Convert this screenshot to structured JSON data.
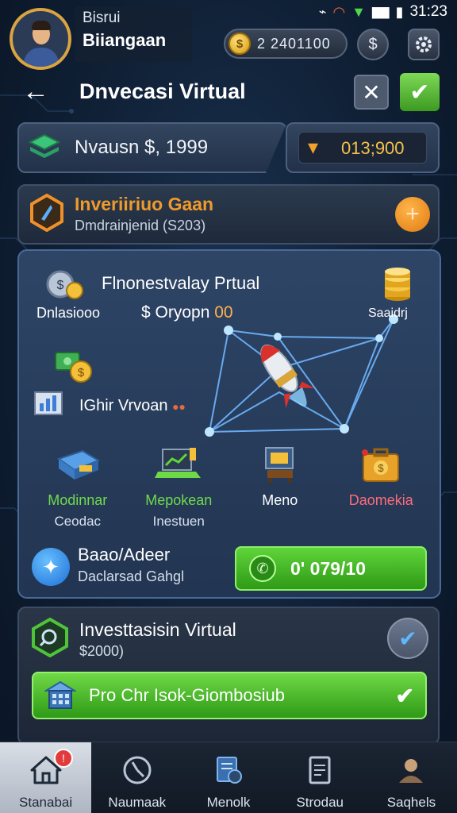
{
  "status_bar": {
    "time": "31:23"
  },
  "profile": {
    "greeting": "Bisrui",
    "name": "Biiangaan"
  },
  "wallet": {
    "coins": "2 2401100"
  },
  "header": {
    "title": "Dnvecasi Virtual"
  },
  "balance": {
    "label": "Nvausn $, 1999"
  },
  "reward": {
    "value": "013;900"
  },
  "invest_card": {
    "title": "Inveriiriuo Gaan",
    "subtitle": "Dmdrainjenid (S203)"
  },
  "main_panel": {
    "title": "Flnonestvalay Prtual",
    "left_label": "Dnlasiooo",
    "mid_label_prefix": "$ Oryopn",
    "mid_label_value": "00",
    "right_label": "Saaidrj",
    "chart_label": "IGhir Vrvoan",
    "chart_dots": "●●",
    "grid": [
      {
        "name": "grid-item-modinnar",
        "l1": "Modinnar",
        "l2": "Ceodac",
        "color": "#6fdb4a",
        "icon": "server-icon"
      },
      {
        "name": "grid-item-mepokean",
        "l1": "Mepokean",
        "l2": "Inestuen",
        "color": "#6fdb4a",
        "icon": "laptop-chart-icon"
      },
      {
        "name": "grid-item-meno",
        "l1": "Meno",
        "l2": "",
        "color": "#ffffff",
        "icon": "monitor-icon"
      },
      {
        "name": "grid-item-daomekia",
        "l1": "Daomekia",
        "l2": "",
        "color": "#ff6b7a",
        "icon": "briefcase-icon"
      }
    ],
    "support_title": "Baao/Adeer",
    "support_sub": "Daclarsad Gahgl",
    "action_value": "0' 079/10"
  },
  "bottom_card": {
    "title": "Investtasisin Virtual",
    "subtitle": "$2000)",
    "action_label": "Pro Chr Isok-Giombosiub"
  },
  "nav": [
    {
      "name": "nav-beranda",
      "label": "Stanabai",
      "icon": "home-icon",
      "active": true,
      "badge": "!"
    },
    {
      "name": "nav-nanmaak",
      "label": "Naumaak",
      "icon": "clock-icon",
      "active": false
    },
    {
      "name": "nav-menolk",
      "label": "Menolk",
      "icon": "document-icon",
      "active": false
    },
    {
      "name": "nav-strodau",
      "label": "Strodau",
      "icon": "receipt-icon",
      "active": false
    },
    {
      "name": "nav-saqhels",
      "label": "Saqhels",
      "icon": "person-icon",
      "active": false
    }
  ]
}
